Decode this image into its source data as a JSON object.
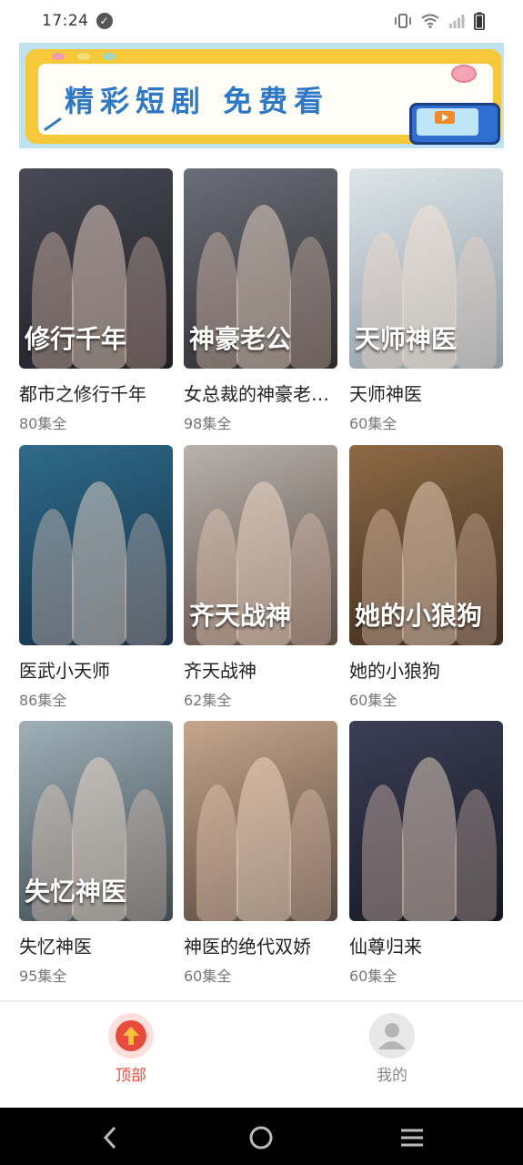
{
  "status_bar": {
    "time": "17:24"
  },
  "banner": {
    "text": "精彩短剧 免费看",
    "colors": {
      "frame": "#f7c83a",
      "text": "#2f78c6",
      "sky": "#bfe2ef"
    }
  },
  "dramas": [
    {
      "title": "都市之修行千年",
      "episodes": "80集全",
      "poster_text": "修行千年",
      "colors": [
        "#4a4a55",
        "#1e1e24"
      ]
    },
    {
      "title": "女总裁的神豪老…",
      "episodes": "98集全",
      "poster_text": "神豪老公",
      "colors": [
        "#6a6e78",
        "#2c2b2d"
      ]
    },
    {
      "title": "天师神医",
      "episodes": "60集全",
      "poster_text": "天师神医",
      "colors": [
        "#dfe6ea",
        "#8b9aa3"
      ]
    },
    {
      "title": "医武小天师",
      "episodes": "86集全",
      "poster_text": "",
      "colors": [
        "#2e6b8a",
        "#152e45"
      ]
    },
    {
      "title": "齐天战神",
      "episodes": "62集全",
      "poster_text": "齐天战神",
      "colors": [
        "#b8b2ad",
        "#5b4b43"
      ]
    },
    {
      "title": "她的小狼狗",
      "episodes": "60集全",
      "poster_text": "她的小狼狗",
      "colors": [
        "#8d6a45",
        "#3b2a1e"
      ]
    },
    {
      "title": "失忆神医",
      "episodes": "95集全",
      "poster_text": "失忆神医",
      "colors": [
        "#9fb0b7",
        "#3e4a50"
      ]
    },
    {
      "title": "神医的绝代双娇",
      "episodes": "60集全",
      "poster_text": "",
      "colors": [
        "#c7a68c",
        "#54473f"
      ]
    },
    {
      "title": "仙尊归来",
      "episodes": "60集全",
      "poster_text": "",
      "colors": [
        "#3c3f55",
        "#151824"
      ]
    }
  ],
  "bottom_nav": {
    "top_label": "顶部",
    "me_label": "我的",
    "active_color": "#e84b3c",
    "inactive_color": "#888888"
  }
}
